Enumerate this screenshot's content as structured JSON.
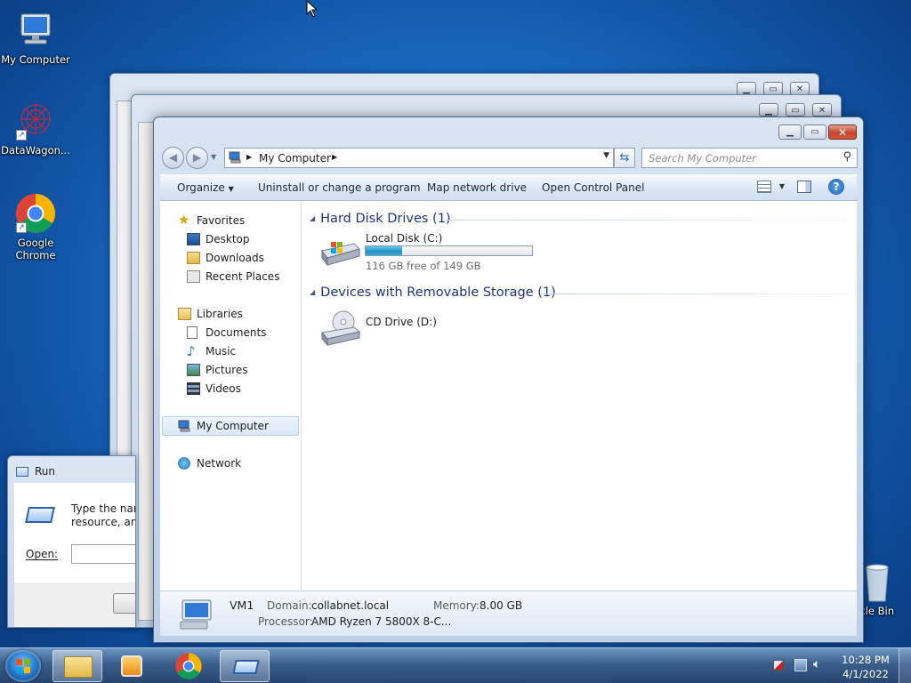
{
  "desktop": {
    "icons": [
      {
        "label": "My Computer"
      },
      {
        "label": "DataWagon..."
      },
      {
        "label": "Google Chrome"
      },
      {
        "label": "cle Bin"
      }
    ]
  },
  "explorer": {
    "address": {
      "crumb": "My Computer"
    },
    "search": {
      "placeholder": "Search My Computer"
    },
    "commands": {
      "organize": "Organize",
      "uninstall": "Uninstall or change a program",
      "map_drive": "Map network drive",
      "control_panel": "Open Control Panel"
    },
    "nav": {
      "favorites": "Favorites",
      "desktop": "Desktop",
      "downloads": "Downloads",
      "recent": "Recent Places",
      "libraries": "Libraries",
      "documents": "Documents",
      "music": "Music",
      "pictures": "Pictures",
      "videos": "Videos",
      "my_computer": "My Computer",
      "network": "Network"
    },
    "groups": {
      "hdd": "Hard Disk Drives (1)",
      "removable": "Devices with Removable Storage (1)"
    },
    "drives": {
      "c_label": "Local Disk (C:)",
      "c_free": "116 GB free of 149 GB",
      "c_used_fraction": 0.22,
      "d_label": "CD Drive (D:)"
    },
    "details": {
      "name": "VM1",
      "domain_key": "Domain:",
      "domain_val": "collabnet.local",
      "memory_key": "Memory:",
      "memory_val": "8.00 GB",
      "processor_key": "Processor:",
      "processor_val": "AMD Ryzen 7 5800X 8-C..."
    }
  },
  "run_dialog": {
    "title": "Run",
    "desc_line1": "Type the nan",
    "desc_line2": "resource, and",
    "open_label": "Open:"
  },
  "taskbar": {
    "time": "10:28 PM",
    "date": "4/1/2022"
  }
}
